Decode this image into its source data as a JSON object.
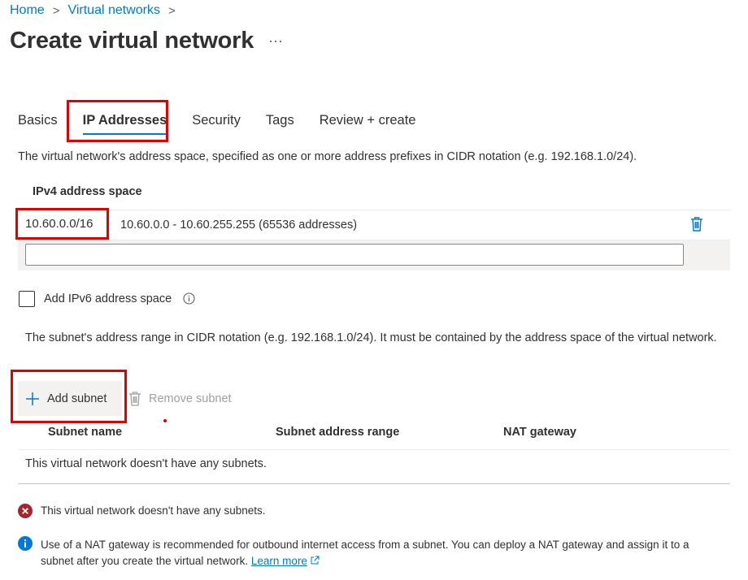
{
  "breadcrumb": {
    "home": "Home",
    "parent": "Virtual networks"
  },
  "page": {
    "title": "Create virtual network",
    "more": "···"
  },
  "tabs": [
    {
      "label": "Basics"
    },
    {
      "label": "IP Addresses"
    },
    {
      "label": "Security"
    },
    {
      "label": "Tags"
    },
    {
      "label": "Review + create"
    }
  ],
  "address_space": {
    "description": "The virtual network's address space, specified as one or more address prefixes in CIDR notation (e.g. 192.168.1.0/24).",
    "ipv4_label": "IPv4 address space",
    "prefix": "10.60.0.0/16",
    "range": "10.60.0.0 - 10.60.255.255 (65536 addresses)",
    "new_value": "",
    "add_ipv6_label": "Add IPv6 address space"
  },
  "subnets": {
    "description": "The subnet's address range in CIDR notation (e.g. 192.168.1.0/24). It must be contained by the address space of the virtual network.",
    "add_button": "Add subnet",
    "remove_button": "Remove subnet",
    "columns": [
      "Subnet name",
      "Subnet address range",
      "NAT gateway"
    ],
    "empty_text": "This virtual network doesn't have any subnets."
  },
  "messages": {
    "error": "This virtual network doesn't have any subnets.",
    "info": "Use of a NAT gateway is recommended for outbound internet access from a subnet. You can deploy a NAT gateway and assign it to a subnet after you create the virtual network.",
    "learn_more": "Learn more"
  },
  "colors": {
    "accent": "#0078d4",
    "highlight_box": "#e00000",
    "error": "#a4262c"
  }
}
